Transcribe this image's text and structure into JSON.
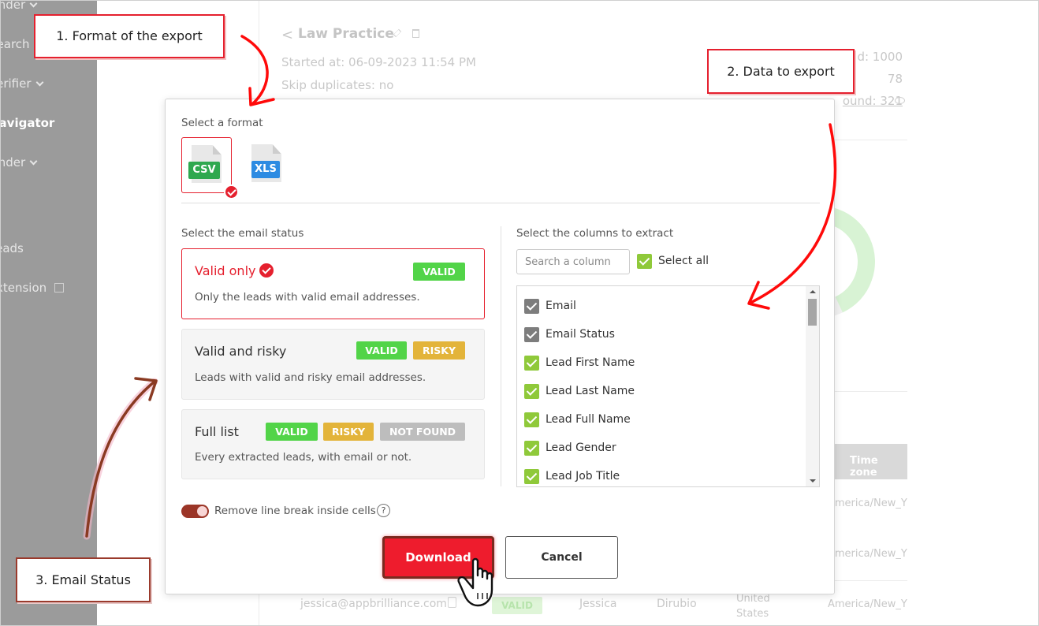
{
  "sidebar": {
    "items": [
      {
        "label": "Finder",
        "chevron": true
      },
      {
        "label": "Search",
        "chevron": false
      },
      {
        "label": "Verifier",
        "chevron": true
      },
      {
        "label": "Navigator",
        "chevron": false,
        "active": true
      },
      {
        "label": "Finder",
        "chevron": true
      },
      {
        "label": "Leads",
        "chevron": false
      },
      {
        "label": "extension",
        "chevron": false,
        "external": true
      }
    ]
  },
  "background": {
    "back_glyph": "<",
    "title": "Law Practice",
    "started": "Started at: 06-09-2023 11:54 PM",
    "skip_duplicates": "Skip duplicates: no",
    "right_1": "d: 1000",
    "right_2": "78",
    "right_3": "ound: 321",
    "table_header_timezone": "Time zone",
    "tz_values": [
      "America/New_Y",
      "America/New_Y",
      "America/New_Y"
    ],
    "row": {
      "email": "jessica@appbrilliance.com",
      "status": "VALID",
      "first_name": "Jessica",
      "last_name": "Dirubio",
      "country_line1": "United",
      "country_line2": "States"
    }
  },
  "modal": {
    "format_label": "Select a format",
    "formats": [
      {
        "id": "csv",
        "label": "CSV",
        "selected": true
      },
      {
        "id": "xls",
        "label": "XLS",
        "selected": false
      }
    ],
    "email_status_label": "Select the email status",
    "options": [
      {
        "title": "Valid only",
        "desc": "Only the leads with valid email addresses.",
        "badges": [
          "VALID"
        ],
        "selected": true
      },
      {
        "title": "Valid and risky",
        "desc": "Leads with valid and risky email addresses.",
        "badges": [
          "VALID",
          "RISKY"
        ],
        "selected": false
      },
      {
        "title": "Full list",
        "desc": "Every extracted leads, with email or not.",
        "badges": [
          "VALID",
          "RISKY",
          "NOT FOUND"
        ],
        "selected": false
      }
    ],
    "columns_label": "Select the columns to extract",
    "search_placeholder": "Search a column",
    "select_all_label": "Select all",
    "columns": [
      {
        "label": "Email",
        "checked": true,
        "locked": true
      },
      {
        "label": "Email Status",
        "checked": true,
        "locked": true
      },
      {
        "label": "Lead First Name",
        "checked": true,
        "locked": false
      },
      {
        "label": "Lead Last Name",
        "checked": true,
        "locked": false
      },
      {
        "label": "Lead Full Name",
        "checked": true,
        "locked": false
      },
      {
        "label": "Lead Gender",
        "checked": true,
        "locked": false
      },
      {
        "label": "Lead Job Title",
        "checked": true,
        "locked": false
      }
    ],
    "toggle_label": "Remove line break inside cells",
    "toggle_on": true,
    "help_glyph": "?",
    "download_label": "Download",
    "cancel_label": "Cancel"
  },
  "annotations": {
    "callout_1": "1. Format of the export",
    "callout_2": "2. Data to export",
    "callout_3": "3. Email Status"
  },
  "colors": {
    "accent_red": "#e5202e",
    "valid_green": "#52d448",
    "risky_yellow": "#e3b43a",
    "notfound_gray": "#bdbdbd",
    "checkbox_green": "#8fc93a",
    "checkbox_gray": "#7d7d7d",
    "annotation_brown": "#9a3a2c"
  }
}
